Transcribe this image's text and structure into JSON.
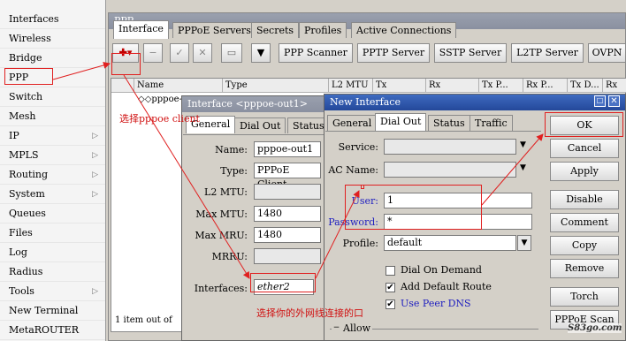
{
  "sidebar": {
    "items": [
      {
        "label": "Interfaces",
        "arrow": ""
      },
      {
        "label": "Wireless",
        "arrow": ""
      },
      {
        "label": "Bridge",
        "arrow": ""
      },
      {
        "label": "PPP",
        "arrow": ""
      },
      {
        "label": "Switch",
        "arrow": ""
      },
      {
        "label": "Mesh",
        "arrow": ""
      },
      {
        "label": "IP",
        "arrow": "▷"
      },
      {
        "label": "MPLS",
        "arrow": "▷"
      },
      {
        "label": "Routing",
        "arrow": "▷"
      },
      {
        "label": "System",
        "arrow": "▷"
      },
      {
        "label": "Queues",
        "arrow": ""
      },
      {
        "label": "Files",
        "arrow": ""
      },
      {
        "label": "Log",
        "arrow": ""
      },
      {
        "label": "Radius",
        "arrow": ""
      },
      {
        "label": "Tools",
        "arrow": "▷"
      },
      {
        "label": "New Terminal",
        "arrow": ""
      },
      {
        "label": "MetaROUTER",
        "arrow": ""
      }
    ]
  },
  "ppp_window": {
    "title": "PPP",
    "tabs": [
      "Interface",
      "PPPoE Servers",
      "Secrets",
      "Profiles",
      "Active Connections"
    ],
    "toolbar": {
      "add": "✚▾",
      "remove": "−",
      "enable": "✓",
      "disable": "✕",
      "comment": "▭",
      "filter": "▼",
      "buttons": [
        "PPP Scanner",
        "PPTP Server",
        "SSTP Server",
        "L2TP Server",
        "OVPN"
      ]
    },
    "columns": [
      "Name",
      "Type",
      "L2 MTU",
      "Tx",
      "Rx",
      "Tx P...",
      "Rx P...",
      "Tx D...",
      "Rx"
    ],
    "row_name": "◇◇pppoe-",
    "status": "1 item out of"
  },
  "iface_dialog": {
    "title": "Interface <pppoe-out1>",
    "tabs": [
      "General",
      "Dial Out",
      "Status"
    ],
    "fields": {
      "name_label": "Name:",
      "name": "pppoe-out1",
      "type_label": "Type:",
      "type": "PPPoE Client",
      "l2mtu_label": "L2 MTU:",
      "maxmtu_label": "Max MTU:",
      "maxmtu": "1480",
      "maxmru_label": "Max MRU:",
      "maxmru": "1480",
      "mrru_label": "MRRU:",
      "interfaces_label": "Interfaces:",
      "interfaces": "ether2"
    }
  },
  "new_dialog": {
    "title": "New Interface",
    "tabs": [
      "General",
      "Dial Out",
      "Status",
      "Traffic"
    ],
    "fields": {
      "service_label": "Service:",
      "acname_label": "AC Name:",
      "user_label": "User:",
      "user": "1",
      "password_label": "Password:",
      "password": "*",
      "profile_label": "Profile:",
      "profile": "default"
    },
    "checks": [
      {
        "label": "Dial On Demand",
        "checked": false
      },
      {
        "label": "Add Default Route",
        "checked": true
      },
      {
        "label": "Use Peer DNS",
        "checked": true
      }
    ],
    "allow": "Allow",
    "buttons": [
      "OK",
      "Cancel",
      "Apply",
      "Disable",
      "Comment",
      "Copy",
      "Remove",
      "Torch",
      "PPPoE Scan"
    ]
  },
  "notes": {
    "select_client": "选择pppoe client",
    "select_iface": "选择你的外网线连接的口"
  },
  "watermark": "S83go.com",
  "colors": {
    "annotation": "#e02020",
    "active_title": "#24489a",
    "note_text": "#d01010",
    "blue_label": "#2020c0"
  }
}
